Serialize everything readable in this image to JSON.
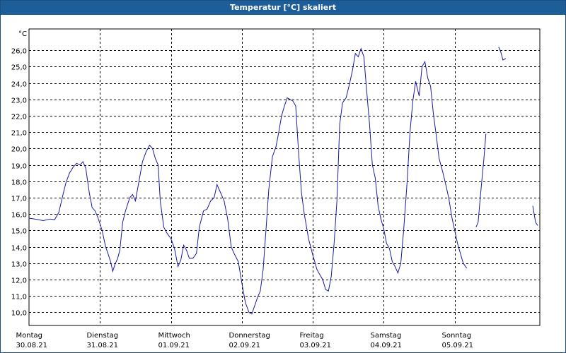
{
  "window": {
    "title": "Temperatur [°C] skaliert"
  },
  "chart_data": {
    "type": "line",
    "title": "Temperatur [°C] skaliert",
    "ylabel": "°C",
    "ylim": [
      9.2,
      27.3
    ],
    "yticks": [
      10.0,
      11.0,
      12.0,
      13.0,
      14.0,
      15.0,
      16.0,
      17.0,
      18.0,
      19.0,
      20.0,
      21.0,
      22.0,
      23.0,
      24.0,
      25.0,
      26.0
    ],
    "ytick_labels": [
      "10,0",
      "11,0",
      "12,0",
      "13,0",
      "14,0",
      "15,0",
      "16,0",
      "17,0",
      "18,0",
      "19,0",
      "20,0",
      "21,0",
      "22,0",
      "23,0",
      "24,0",
      "25,0",
      "26,0"
    ],
    "xlim": [
      0,
      7.2
    ],
    "x_unit": "days since 30.08.21 00:00",
    "days": [
      {
        "weekday": "Montag",
        "date": "30.08.21"
      },
      {
        "weekday": "Dienstag",
        "date": "31.08.21"
      },
      {
        "weekday": "Mittwoch",
        "date": "01.09.21"
      },
      {
        "weekday": "Donnerstag",
        "date": "02.09.21"
      },
      {
        "weekday": "Freitag",
        "date": "03.09.21"
      },
      {
        "weekday": "Samstag",
        "date": "04.09.21"
      },
      {
        "weekday": "Sonntag",
        "date": "05.09.21"
      }
    ],
    "grid": true,
    "line_color": "#1a1aa6",
    "series": [
      {
        "segments": [
          [
            [
              0.0,
              15.75
            ],
            [
              0.08,
              15.7
            ],
            [
              0.2,
              15.6
            ],
            [
              0.3,
              15.7
            ],
            [
              0.36,
              15.65
            ],
            [
              0.42,
              16.1
            ],
            [
              0.48,
              17.2
            ],
            [
              0.52,
              17.9
            ],
            [
              0.57,
              18.5
            ],
            [
              0.62,
              18.85
            ],
            [
              0.67,
              19.1
            ],
            [
              0.72,
              19.0
            ],
            [
              0.76,
              19.2
            ],
            [
              0.8,
              18.8
            ],
            [
              0.85,
              17.3
            ],
            [
              0.89,
              16.4
            ],
            [
              0.93,
              16.2
            ],
            [
              0.97,
              15.8
            ],
            [
              1.03,
              15.0
            ],
            [
              1.08,
              14.0
            ],
            [
              1.12,
              13.5
            ],
            [
              1.15,
              13.1
            ],
            [
              1.18,
              12.5
            ],
            [
              1.21,
              12.9
            ],
            [
              1.25,
              13.3
            ],
            [
              1.28,
              13.8
            ],
            [
              1.32,
              15.5
            ],
            [
              1.36,
              16.2
            ],
            [
              1.42,
              17.0
            ],
            [
              1.46,
              17.2
            ],
            [
              1.5,
              16.8
            ],
            [
              1.55,
              18.0
            ],
            [
              1.6,
              19.2
            ],
            [
              1.65,
              19.8
            ],
            [
              1.7,
              20.2
            ],
            [
              1.74,
              20.0
            ],
            [
              1.78,
              19.4
            ],
            [
              1.82,
              19.0
            ],
            [
              1.85,
              16.8
            ],
            [
              1.9,
              15.2
            ],
            [
              1.95,
              14.8
            ],
            [
              2.0,
              14.5
            ],
            [
              2.05,
              13.9
            ],
            [
              2.1,
              12.8
            ],
            [
              2.14,
              13.2
            ],
            [
              2.18,
              14.1
            ],
            [
              2.22,
              13.8
            ],
            [
              2.26,
              13.3
            ],
            [
              2.31,
              13.3
            ],
            [
              2.36,
              13.6
            ],
            [
              2.4,
              15.2
            ],
            [
              2.46,
              16.2
            ],
            [
              2.51,
              16.3
            ],
            [
              2.56,
              16.8
            ],
            [
              2.61,
              17.0
            ],
            [
              2.65,
              17.8
            ],
            [
              2.7,
              17.3
            ],
            [
              2.75,
              16.8
            ],
            [
              2.8,
              15.7
            ],
            [
              2.85,
              14.0
            ],
            [
              2.89,
              13.6
            ],
            [
              2.95,
              13.1
            ],
            [
              3.0,
              11.8
            ],
            [
              3.05,
              10.6
            ],
            [
              3.1,
              10.0
            ],
            [
              3.14,
              9.9
            ],
            [
              3.18,
              10.4
            ],
            [
              3.22,
              10.9
            ],
            [
              3.26,
              11.3
            ],
            [
              3.3,
              12.6
            ],
            [
              3.34,
              15.0
            ],
            [
              3.38,
              17.5
            ],
            [
              3.43,
              19.5
            ],
            [
              3.48,
              20.1
            ],
            [
              3.52,
              21.0
            ],
            [
              3.56,
              22.0
            ],
            [
              3.6,
              22.6
            ],
            [
              3.64,
              23.1
            ],
            [
              3.68,
              23.0
            ],
            [
              3.72,
              22.9
            ],
            [
              3.76,
              22.6
            ],
            [
              3.8,
              19.7
            ],
            [
              3.84,
              17.3
            ],
            [
              3.88,
              16.0
            ],
            [
              3.94,
              14.5
            ],
            [
              4.0,
              13.5
            ],
            [
              4.06,
              12.6
            ],
            [
              4.1,
              12.3
            ],
            [
              4.14,
              12.0
            ],
            [
              4.18,
              11.4
            ],
            [
              4.22,
              11.3
            ],
            [
              4.26,
              12.2
            ],
            [
              4.3,
              14.2
            ],
            [
              4.34,
              16.8
            ],
            [
              4.38,
              21.5
            ],
            [
              4.42,
              22.8
            ],
            [
              4.47,
              23.1
            ],
            [
              4.52,
              24.0
            ],
            [
              4.56,
              24.8
            ],
            [
              4.6,
              25.8
            ],
            [
              4.64,
              25.6
            ],
            [
              4.68,
              26.1
            ],
            [
              4.72,
              25.6
            ],
            [
              4.76,
              23.5
            ],
            [
              4.8,
              21.5
            ],
            [
              4.84,
              19.0
            ],
            [
              4.88,
              18.2
            ],
            [
              4.92,
              16.5
            ],
            [
              4.96,
              15.7
            ],
            [
              5.0,
              15.1
            ],
            [
              5.04,
              14.2
            ],
            [
              5.08,
              13.9
            ],
            [
              5.12,
              13.1
            ],
            [
              5.16,
              12.8
            ],
            [
              5.2,
              12.4
            ],
            [
              5.24,
              13.0
            ],
            [
              5.28,
              15.0
            ],
            [
              5.33,
              18.0
            ],
            [
              5.37,
              21.0
            ],
            [
              5.41,
              22.9
            ],
            [
              5.45,
              24.1
            ],
            [
              5.5,
              23.2
            ],
            [
              5.54,
              25.0
            ],
            [
              5.58,
              25.3
            ],
            [
              5.62,
              24.3
            ],
            [
              5.66,
              23.8
            ],
            [
              5.7,
              22.1
            ],
            [
              5.74,
              20.8
            ],
            [
              5.78,
              19.4
            ],
            [
              5.83,
              18.6
            ],
            [
              5.88,
              17.7
            ],
            [
              5.92,
              16.9
            ],
            [
              5.96,
              15.8
            ],
            [
              6.0,
              15.0
            ],
            [
              6.04,
              14.2
            ],
            [
              6.08,
              13.6
            ],
            [
              6.12,
              13.0
            ],
            [
              6.17,
              12.7
            ]
          ],
          [
            [
              6.3,
              15.2
            ],
            [
              6.33,
              15.5
            ],
            [
              6.36,
              17.0
            ],
            [
              6.39,
              18.4
            ],
            [
              6.41,
              19.3
            ],
            [
              6.44,
              20.9
            ]
          ],
          [
            [
              6.62,
              26.2
            ],
            [
              6.65,
              25.9
            ],
            [
              6.68,
              25.4
            ],
            [
              6.72,
              25.5
            ]
          ],
          [
            [
              7.1,
              16.5
            ],
            [
              7.14,
              15.5
            ],
            [
              7.17,
              15.3
            ]
          ]
        ]
      }
    ]
  }
}
